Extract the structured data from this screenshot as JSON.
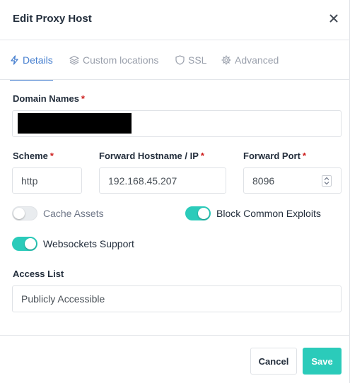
{
  "modal": {
    "title": "Edit Proxy Host",
    "close_icon": "close-icon"
  },
  "tabs": [
    {
      "label": "Details",
      "icon": "lightning-icon",
      "active": true
    },
    {
      "label": "Custom locations",
      "icon": "layers-icon",
      "active": false
    },
    {
      "label": "SSL",
      "icon": "shield-icon",
      "active": false
    },
    {
      "label": "Advanced",
      "icon": "gear-icon",
      "active": false
    }
  ],
  "form": {
    "domain_names": {
      "label": "Domain Names",
      "required_mark": "*",
      "value": ""
    },
    "scheme": {
      "label": "Scheme",
      "required_mark": "*",
      "value": "http"
    },
    "forward_host": {
      "label": "Forward Hostname / IP",
      "required_mark": "*",
      "value": "192.168.45.207"
    },
    "forward_port": {
      "label": "Forward Port",
      "required_mark": "*",
      "value": "8096"
    },
    "toggles": {
      "cache_assets": {
        "label": "Cache Assets",
        "enabled": false
      },
      "block_exploits": {
        "label": "Block Common Exploits",
        "enabled": true
      },
      "websockets": {
        "label": "Websockets Support",
        "enabled": true
      }
    },
    "access_list": {
      "label": "Access List",
      "value": "Publicly Accessible"
    }
  },
  "footer": {
    "cancel_label": "Cancel",
    "save_label": "Save"
  },
  "colors": {
    "accent": "#467fcf",
    "toggle_on": "#2bcbba",
    "required": "#cd201f"
  }
}
